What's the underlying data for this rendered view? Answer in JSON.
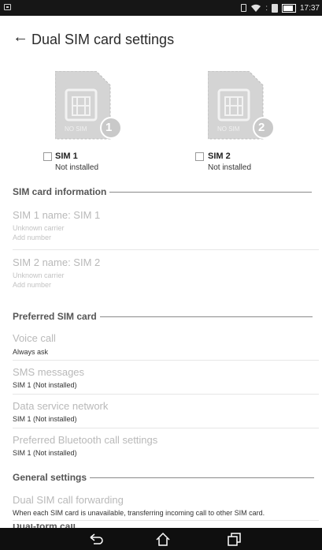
{
  "status_bar": {
    "time": "17:37"
  },
  "header": {
    "title": "Dual SIM card settings"
  },
  "sims": [
    {
      "badge_text": "NO SIM",
      "number": "1",
      "label": "SIM 1",
      "status": "Not installed"
    },
    {
      "badge_text": "NO SIM",
      "number": "2",
      "label": "SIM 2",
      "status": "Not installed"
    }
  ],
  "sections": {
    "sim_info": "SIM card information",
    "preferred": "Preferred SIM card",
    "general": "General settings",
    "partial": "Dual-form call ..."
  },
  "sim_info_items": [
    {
      "title": "SIM 1 name: SIM 1",
      "carrier": "Unknown carrier",
      "number": "Add number"
    },
    {
      "title": "SIM 2 name: SIM 2",
      "carrier": "Unknown carrier",
      "number": "Add number"
    }
  ],
  "preferred_items": [
    {
      "title": "Voice call",
      "value": "Always ask"
    },
    {
      "title": "SMS messages",
      "value": "SIM 1 (Not installed)"
    },
    {
      "title": "Data service network",
      "value": "SIM 1 (Not installed)"
    },
    {
      "title": "Preferred Bluetooth call settings",
      "value": "SIM 1 (Not installed)"
    }
  ],
  "general_items": [
    {
      "title": "Dual SIM call forwarding",
      "value": "When each SIM card is unavailable, transferring incoming call to other SIM card."
    }
  ],
  "icons": {
    "back": "arrow-left-icon",
    "nav_back": "nav-back-icon",
    "nav_home": "nav-home-icon",
    "nav_recents": "nav-recents-icon"
  }
}
